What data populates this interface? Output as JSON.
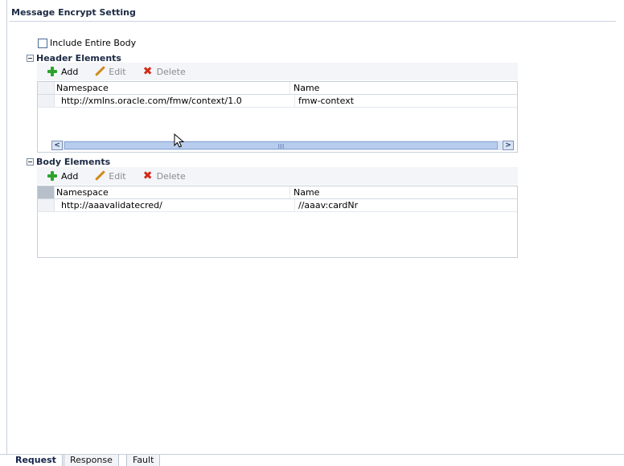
{
  "page": {
    "title": "Message Encrypt Setting",
    "include_body_label": "Include Entire Body"
  },
  "header_section": {
    "title": "Header Elements",
    "toolbar": {
      "add": "Add",
      "edit": "Edit",
      "delete": "Delete"
    },
    "columns": {
      "namespace": "Namespace",
      "name": "Name"
    },
    "rows": [
      {
        "namespace": "http://xmlns.oracle.com/fmw/context/1.0",
        "name": "fmw-context"
      }
    ]
  },
  "body_section": {
    "title": "Body Elements",
    "toolbar": {
      "add": "Add",
      "edit": "Edit",
      "delete": "Delete"
    },
    "columns": {
      "namespace": "Namespace",
      "name": "Name"
    },
    "rows": [
      {
        "namespace": "http://aaavalidatecred/",
        "name": "//aaav:cardNr"
      }
    ]
  },
  "tabs": [
    "Request",
    "Response",
    "Fault"
  ],
  "icons": {
    "add": "plus-icon",
    "edit": "pencil-icon",
    "delete": "x-icon",
    "scroll_left": "arrow-left-icon",
    "scroll_right": "arrow-right-icon",
    "pointer": "mouse-pointer-icon"
  },
  "colors": {
    "add_green": "#2ea22e",
    "delete_red": "#d22b17",
    "heading_blue": "#1c2a44"
  }
}
